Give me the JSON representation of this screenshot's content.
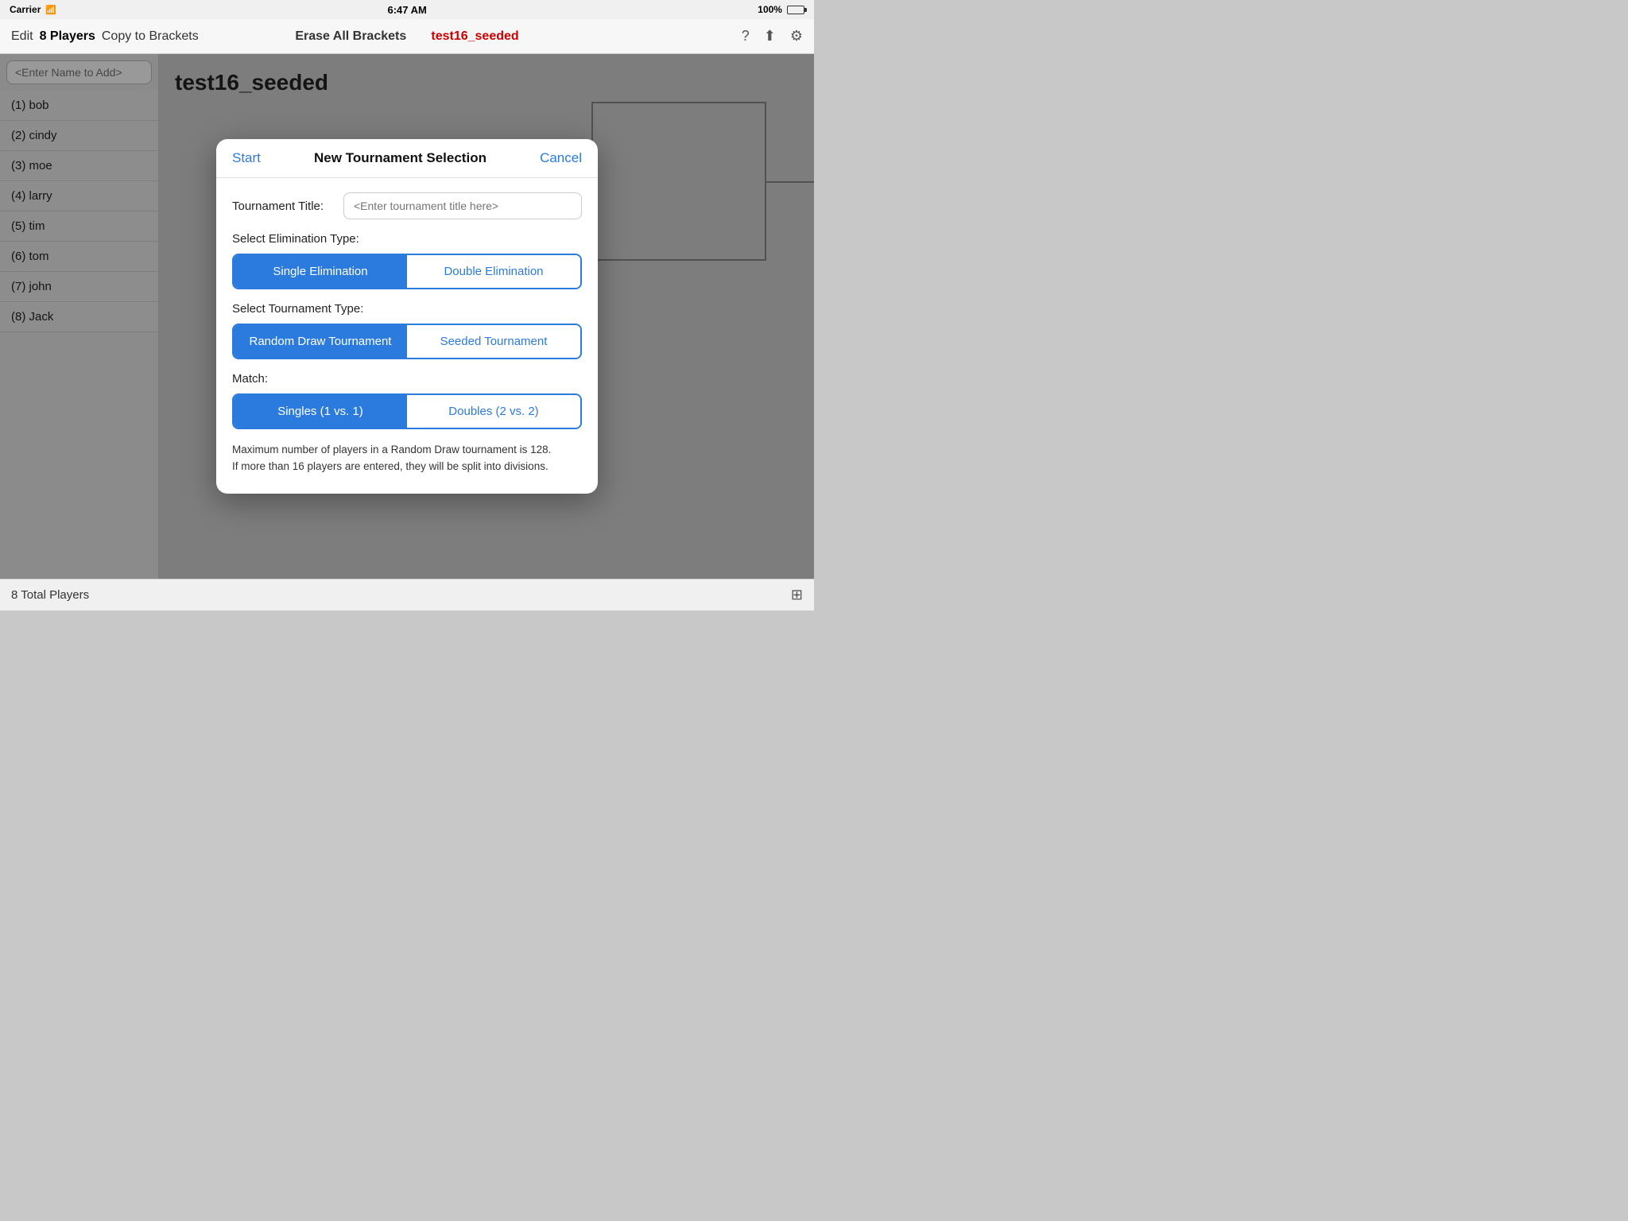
{
  "statusBar": {
    "carrier": "Carrier",
    "time": "6:47 AM",
    "battery": "100%"
  },
  "navBar": {
    "edit": "Edit",
    "players": "8 Players",
    "copyToBrackets": "Copy to Brackets",
    "eraseAllBrackets": "Erase All Brackets",
    "tournamentName": "test16_seeded"
  },
  "leftPanel": {
    "searchPlaceholder": "<Enter Name to Add>",
    "players": [
      "(1) bob",
      "(2) cindy",
      "(3) moe",
      "(4) larry",
      "(5) tim",
      "(6) tom",
      "(7) john",
      "(8) Jack"
    ]
  },
  "rightPanel": {
    "title": "test16_seeded"
  },
  "bottomBar": {
    "totalPlayers": "8 Total Players"
  },
  "modal": {
    "startLabel": "Start",
    "title": "New Tournament Selection",
    "cancelLabel": "Cancel",
    "tournamentTitleLabel": "Tournament Title:",
    "tournamentTitlePlaceholder": "<Enter tournament title here>",
    "eliminationTypeLabel": "Select Elimination Type:",
    "eliminationOptions": [
      {
        "label": "Single Elimination",
        "active": true
      },
      {
        "label": "Double Elimination",
        "active": false
      }
    ],
    "tournamentTypeLabel": "Select Tournament Type:",
    "tournamentOptions": [
      {
        "label": "Random Draw Tournament",
        "active": true
      },
      {
        "label": "Seeded Tournament",
        "active": false
      }
    ],
    "matchLabel": "Match:",
    "matchOptions": [
      {
        "label": "Singles (1 vs. 1)",
        "active": true
      },
      {
        "label": "Doubles (2 vs. 2)",
        "active": false
      }
    ],
    "infoText": "Maximum number of players in a Random Draw tournament is 128.\nIf more than 16 players are entered, they will be split into divisions."
  }
}
